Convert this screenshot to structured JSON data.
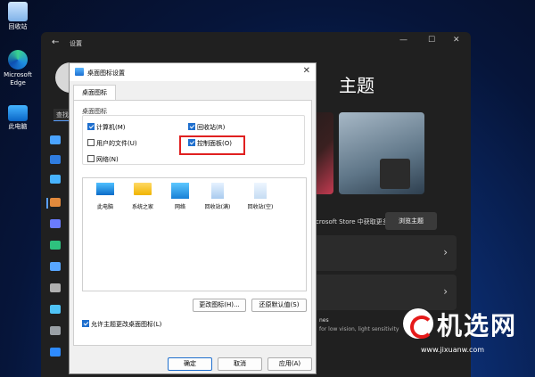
{
  "desktop": {
    "icons": [
      {
        "label": "回收站"
      },
      {
        "label": "Microsoft Edge"
      },
      {
        "label": "此电脑"
      }
    ]
  },
  "settings": {
    "title": "设置",
    "search_placeholder": "查找",
    "heading": "主题",
    "get_more": "Microsoft Store 中获取更多主题",
    "browse_button": "浏览主题",
    "contrast_title": "nes",
    "contrast_desc": "for low vision, light sensitivity"
  },
  "dialog": {
    "title": "桌面图标设置",
    "tab": "桌面图标",
    "group_label": "桌面图标",
    "checkboxes": [
      {
        "label": "计算机(M)",
        "checked": true
      },
      {
        "label": "用户的文件(U)",
        "checked": false
      },
      {
        "label": "网络(N)",
        "checked": false
      },
      {
        "label": "回收站(R)",
        "checked": true
      },
      {
        "label": "控制面板(O)",
        "checked": true
      }
    ],
    "icons": [
      {
        "label": "此电脑"
      },
      {
        "label": "系统之家"
      },
      {
        "label": "网络"
      },
      {
        "label": "回收站(满)"
      },
      {
        "label": "回收站(空)"
      }
    ],
    "change_icon_button": "更改图标(H)...",
    "restore_default_button": "还原默认值(S)",
    "allow_themes_label": "允许主题更改桌面图标(L)",
    "allow_themes_checked": true,
    "ok_button": "确定",
    "cancel_button": "取消",
    "apply_button": "应用(A)"
  },
  "watermark": {
    "text": "机选网",
    "url": "www.jixuanw.com"
  }
}
